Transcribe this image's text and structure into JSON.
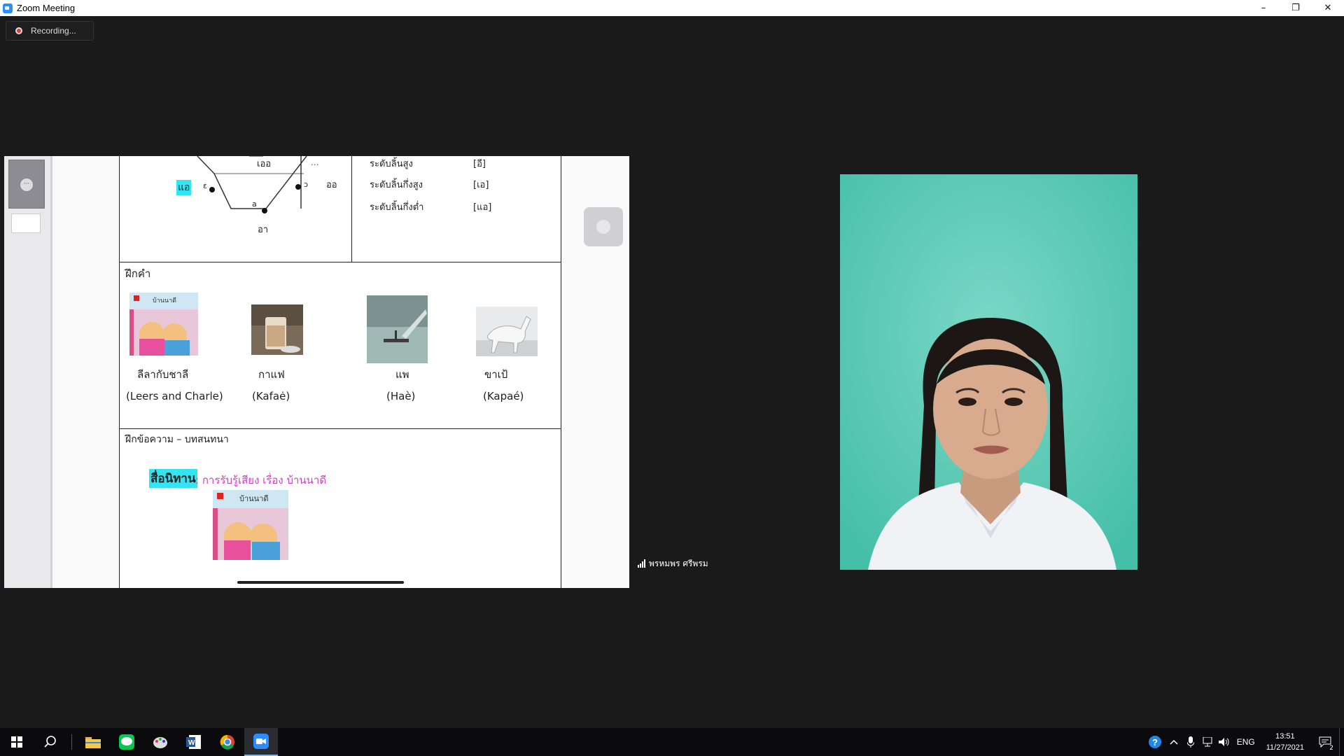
{
  "window": {
    "title": "Zoom Meeting",
    "minimize": "–",
    "restore": "❐",
    "close": "✕"
  },
  "recording": {
    "label": "Recording..."
  },
  "slide": {
    "vowel_labels": {
      "oe": "เออ",
      "ae": "แอ",
      "aw": "ออ",
      "a": "อา",
      "eps": "ɛ",
      "o": "ɔ",
      "a_ipa": "a",
      "dots": "..."
    },
    "table_rows": [
      {
        "level": "ระดับลิ้นสูง",
        "ipa": "[อี]"
      },
      {
        "level": "ระดับลิ้นกึ่งสูง",
        "ipa": "[เอ]"
      },
      {
        "level": "ระดับลิ้นกึ่งต่ำ",
        "ipa": "[แอ]"
      }
    ],
    "section1_title": "ฝึกคำ",
    "words": [
      {
        "thai": "ลีลากับชาลี",
        "roman": "(Leers and Charle)"
      },
      {
        "thai": "กาแฟ",
        "roman": "(Kafaė)"
      },
      {
        "thai": "แพ",
        "roman": "(Haè)"
      },
      {
        "thai": "ขาเป้",
        "roman": "(Kapaé)"
      }
    ],
    "book_title": "บ้านนาดี",
    "section2_title": "ฝึกข้อความ – บทสนทนา",
    "media_highlight": "สื่อนิทาน",
    "media_rest": ":  การรับรู้เสียง   เรื่อง  บ้านนาดี"
  },
  "participant": {
    "name": "พรหมพร ศรีพรม"
  },
  "taskbar": {
    "lang": "ENG",
    "time": "13:51",
    "date": "11/27/2021",
    "notifications": "2"
  },
  "colors": {
    "accent": "#2d8cff",
    "highlight": "#33e5f0",
    "pink": "#d040c0"
  }
}
